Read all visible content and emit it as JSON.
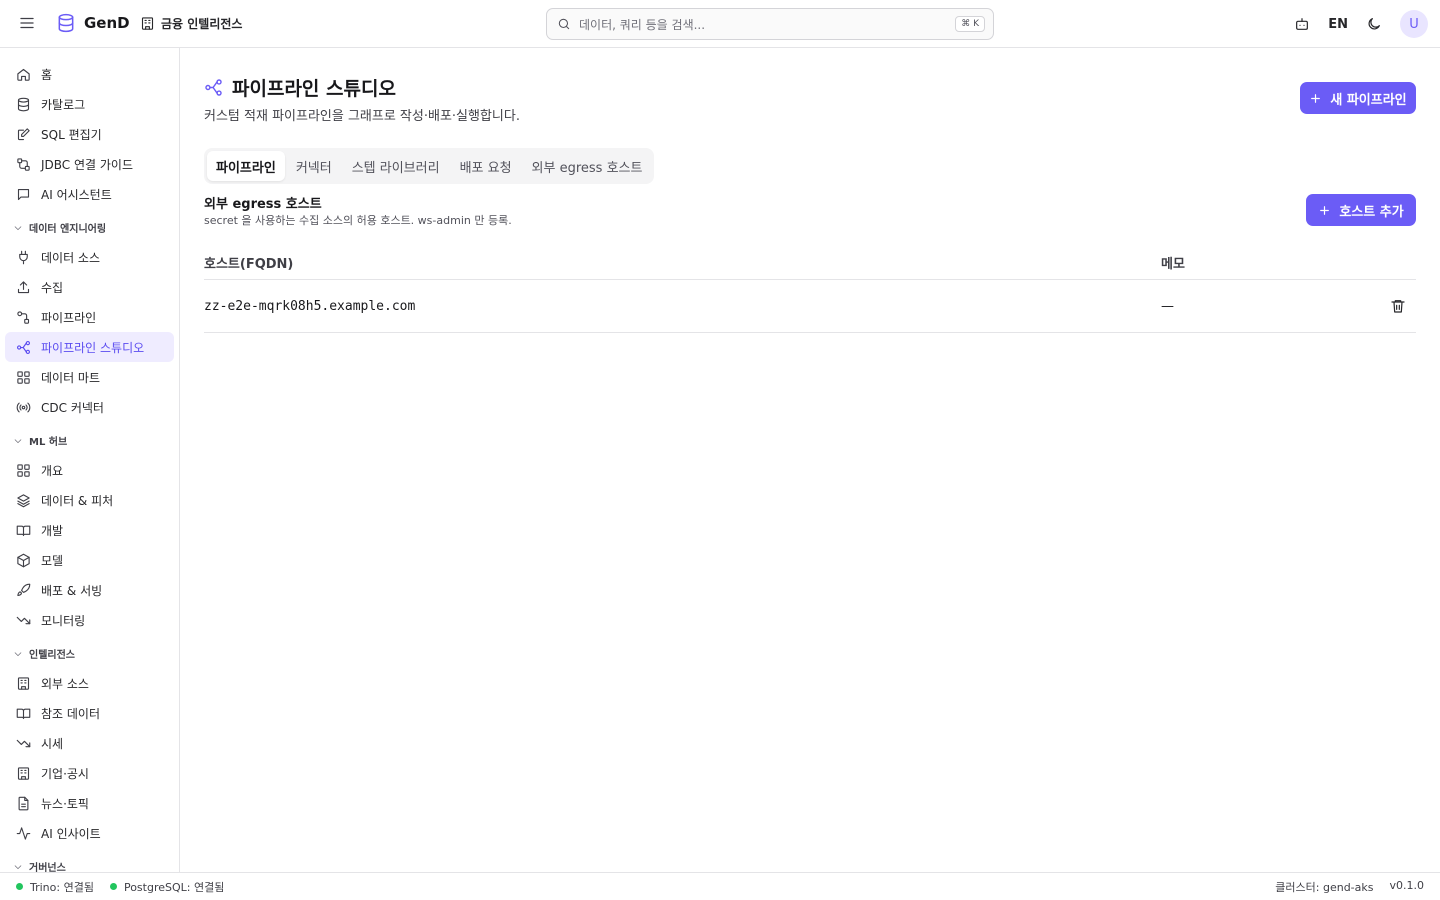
{
  "app": {
    "name": "GenD",
    "org": "금융 인텔리전스",
    "search_placeholder": "데이터, 쿼리 등을 검색...",
    "search_shortcut": "⌘ K",
    "language": "EN",
    "avatar_initial": "U"
  },
  "sidebar": {
    "top_items": [
      {
        "label": "홈",
        "icon": "home-icon"
      },
      {
        "label": "카탈로그",
        "icon": "database-icon"
      },
      {
        "label": "SQL 편집기",
        "icon": "edit-icon"
      },
      {
        "label": "JDBC 연결 가이드",
        "icon": "connection-icon"
      },
      {
        "label": "AI 어시스턴트",
        "icon": "chat-icon"
      }
    ],
    "data_engineering": {
      "title": "데이터 엔지니어링",
      "items": [
        {
          "label": "데이터 소스",
          "icon": "plug-icon"
        },
        {
          "label": "수집",
          "icon": "upload-icon"
        },
        {
          "label": "파이프라인",
          "icon": "pipeline-icon"
        },
        {
          "label": "파이프라인 스튜디오",
          "icon": "workflow-icon",
          "active": true
        },
        {
          "label": "데이터 마트",
          "icon": "grid-icon"
        },
        {
          "label": "CDC 커넥터",
          "icon": "broadcast-icon"
        }
      ]
    },
    "ml_hub": {
      "title": "ML 허브",
      "items": [
        {
          "label": "개요",
          "icon": "grid-icon"
        },
        {
          "label": "데이터 & 피처",
          "icon": "layers-icon"
        },
        {
          "label": "개발",
          "icon": "book-icon"
        },
        {
          "label": "모델",
          "icon": "box-icon"
        },
        {
          "label": "배포 & 서빙",
          "icon": "rocket-icon"
        },
        {
          "label": "모니터링",
          "icon": "trend-down-icon"
        }
      ]
    },
    "intelligence": {
      "title": "인텔리전스",
      "items": [
        {
          "label": "외부 소스",
          "icon": "building-icon"
        },
        {
          "label": "참조 데이터",
          "icon": "book-icon"
        },
        {
          "label": "시세",
          "icon": "trend-down-icon"
        },
        {
          "label": "기업·공시",
          "icon": "building-icon"
        },
        {
          "label": "뉴스·토픽",
          "icon": "document-icon"
        },
        {
          "label": "AI 인사이트",
          "icon": "activity-icon"
        }
      ]
    },
    "governance": {
      "title": "거버넌스"
    }
  },
  "page": {
    "title": "파이프라인 스튜디오",
    "subtitle": "커스텀 적재 파이프라인을 그래프로 작성·배포·실행합니다.",
    "new_button": "새 파이프라인",
    "tabs": [
      "파이프라인",
      "커넥터",
      "스텝 라이브러리",
      "배포 요청",
      "외부 egress 호스트"
    ],
    "active_tab": 0
  },
  "egress": {
    "title": "외부 egress 호스트",
    "description": "secret 을 사용하는 수집 소스의 허용 호스트. ws-admin 만 등록.",
    "add_button": "호스트 추가",
    "columns": [
      "호스트(FQDN)",
      "메모"
    ],
    "rows": [
      {
        "host": "zz-e2e-mqrk08h5.example.com",
        "memo": "—"
      }
    ]
  },
  "status": {
    "trino": "Trino: 연결됨",
    "postgres": "PostgreSQL: 연결됨",
    "cluster": "클러스터: gend-aks",
    "version": "v0.1.0",
    "ok_color": "#22c55e"
  },
  "colors": {
    "accent": "#6b5cf6",
    "active_bg": "#efecff"
  }
}
